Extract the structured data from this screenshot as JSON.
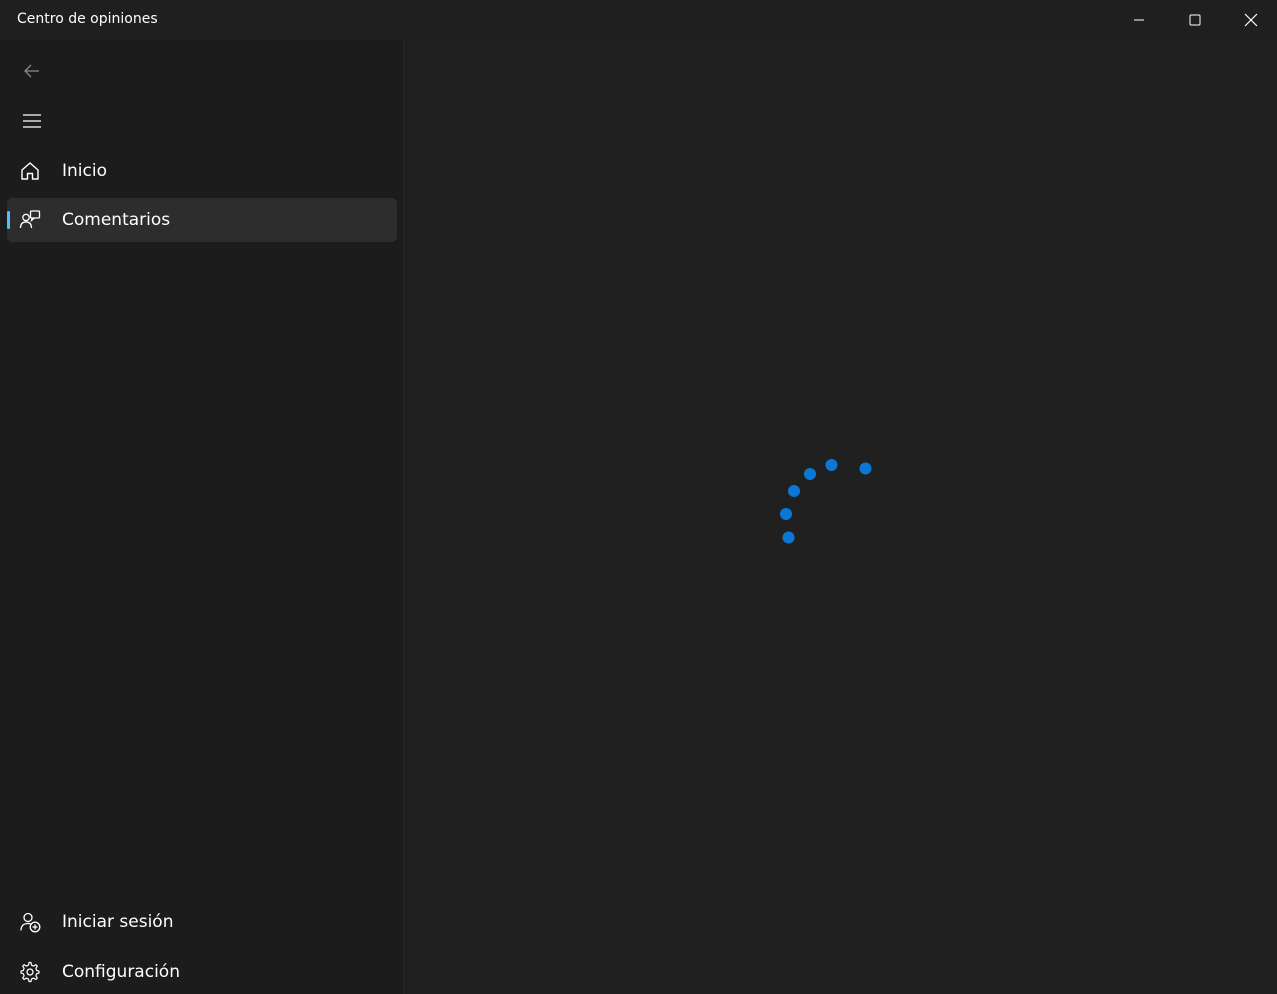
{
  "window": {
    "title": "Centro de opiniones",
    "controls": {
      "minimize_icon": "minimize-icon",
      "maximize_icon": "maximize-icon",
      "close_icon": "close-icon"
    }
  },
  "sidebar": {
    "back_icon": "back-arrow-icon",
    "menu_icon": "hamburger-menu-icon",
    "items": [
      {
        "label": "Inicio",
        "icon": "home-icon",
        "selected": false
      },
      {
        "label": "Comentarios",
        "icon": "feedback-icon",
        "selected": true
      }
    ],
    "footer_items": [
      {
        "label": "Iniciar sesión",
        "icon": "person-add-icon"
      },
      {
        "label": "Configuración",
        "icon": "gear-icon"
      }
    ]
  },
  "content": {
    "state": "loading",
    "spinner_icon": "loading-spinner-icon"
  },
  "colors": {
    "accent": "#4cc2ff",
    "spinner": "#0a78d4",
    "sidebar_bg": "#1c1c1c",
    "content_bg": "#202020",
    "selected_bg": "#2d2d2d"
  }
}
